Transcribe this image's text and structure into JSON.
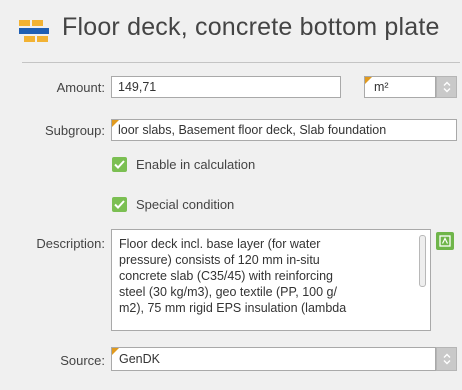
{
  "header": {
    "title": "Floor deck, concrete bottom plate",
    "icon": "floor-deck-icon"
  },
  "amount": {
    "label": "Amount:",
    "value": "149,71",
    "unit": "m²"
  },
  "subgroup": {
    "label": "Subgroup:",
    "value": "loor slabs, Basement floor deck, Slab foundation"
  },
  "checks": {
    "enable_label": "Enable in calculation",
    "enable_checked": true,
    "special_label": "Special condition",
    "special_checked": true
  },
  "description": {
    "label": "Description:",
    "lines": [
      "Floor deck incl. base layer (for water",
      "pressure) consists of 120 mm in-situ",
      "concrete slab (C35/45) with reinforcing",
      "steel (30 kg/m3), geo textile (PP, 100 g/",
      "m2), 75 mm rigid EPS insulation (lambda"
    ]
  },
  "source": {
    "label": "Source:",
    "value": "GenDK"
  },
  "colors": {
    "accent_orange": "#e09a1f",
    "check_green": "#7bbf52",
    "icon_blue": "#1f5fb4"
  }
}
